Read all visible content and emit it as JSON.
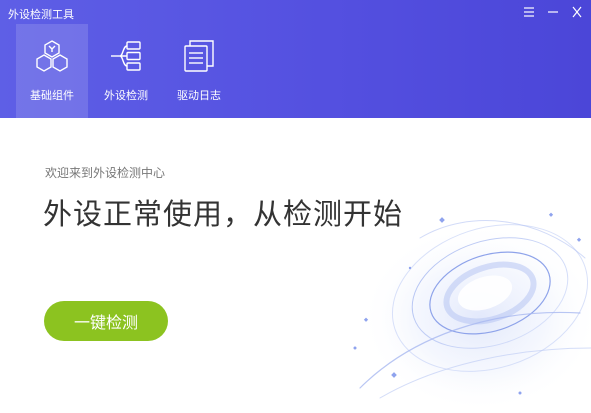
{
  "window": {
    "title": "外设检测工具"
  },
  "titlebar_controls": {
    "menu_icon": "menu-icon",
    "minimize_icon": "minimize-icon",
    "close_icon": "close-icon"
  },
  "nav": {
    "tabs": [
      {
        "label": "基础组件",
        "icon": "hexagon-cluster-icon",
        "active": true
      },
      {
        "label": "外设检测",
        "icon": "tree-structure-icon",
        "active": false
      },
      {
        "label": "驱动日志",
        "icon": "log-document-icon",
        "active": false
      }
    ]
  },
  "main": {
    "welcome": "欢迎来到外设检测中心",
    "headline": "外设正常使用，从检测开始",
    "action_button": "一键检测"
  },
  "colors": {
    "header_start": "#5e5fe6",
    "header_end": "#4b46d8",
    "button_green": "#8cc320",
    "headline_text": "#333333"
  }
}
